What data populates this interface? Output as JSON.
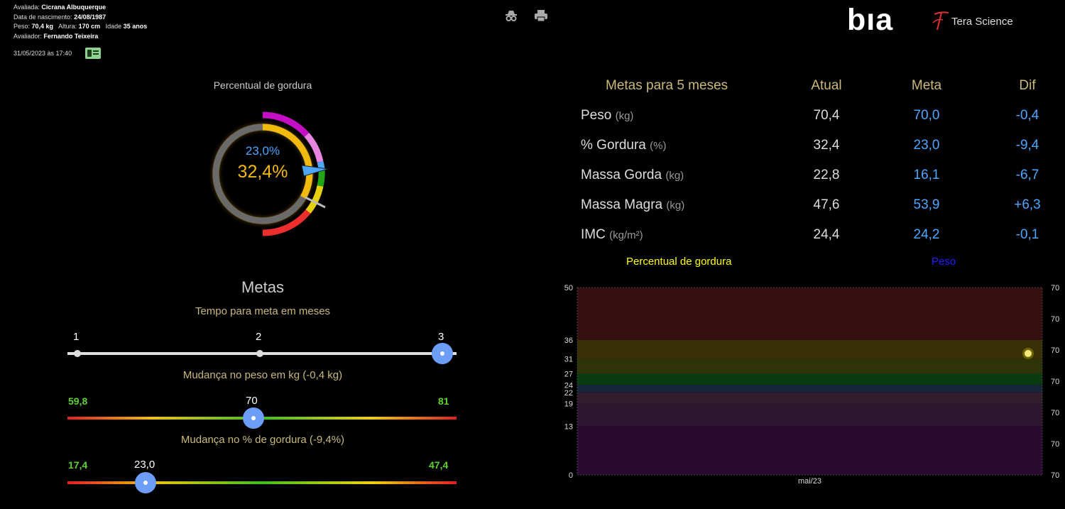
{
  "header": {
    "avaliada_label": "Avaliada:",
    "avaliada_value": "Cicrana Albuquerque",
    "nasc_label": "Data de nascimento:",
    "nasc_value": "24/08/1987",
    "peso_label": "Peso:",
    "peso_value": "70,4 kg",
    "altura_label": "Altura:",
    "altura_value": "170 cm",
    "idade_label": "Idade",
    "idade_value": "35 anos",
    "avaliador_label": "Avaliador:",
    "avaliador_value": "Fernando Teixeira",
    "datetime": "31/05/2023 às 17:40",
    "icons": [
      "id-card-icon",
      "incognito-icon",
      "printer-icon"
    ]
  },
  "logos": {
    "bia": "bıa",
    "tera": "Tera Science"
  },
  "gauge": {
    "title": "Percentual de gordura",
    "target": "23,0%",
    "current": "32,4%",
    "current_fraction": 0.324,
    "colors": {
      "current": "#f2b90f",
      "target": "#4da6ff",
      "track": "#6a6a6a"
    }
  },
  "metas": {
    "title": "Metas",
    "tempo": {
      "label": "Tempo para meta em meses",
      "ticks": [
        "1",
        "2",
        "3"
      ],
      "selected_index": 2
    },
    "peso": {
      "label": "Mudança no peso em kg (-0,4 kg)",
      "min": "59,8",
      "max": "81",
      "value": "70",
      "min_num": 59.8,
      "max_num": 81,
      "value_num": 70
    },
    "gordura": {
      "label": "Mudança no % de gordura (-9,4%)",
      "min": "17,4",
      "max": "47,4",
      "value": "23,0",
      "min_num": 17.4,
      "max_num": 47.4,
      "value_num": 23.0
    }
  },
  "goals_table": {
    "headers": [
      "Metas para 5 meses",
      "Atual",
      "Meta",
      "Dif"
    ],
    "rows": [
      {
        "label": "Peso",
        "unit": "(kg)",
        "atual": "70,4",
        "meta": "70,0",
        "dif": "-0,4"
      },
      {
        "label": "% Gordura",
        "unit": "(%)",
        "atual": "32,4",
        "meta": "23,0",
        "dif": "-9,4"
      },
      {
        "label": "Massa Gorda",
        "unit": "(kg)",
        "atual": "22,8",
        "meta": "16,1",
        "dif": "-6,7"
      },
      {
        "label": "Massa Magra",
        "unit": "(kg)",
        "atual": "47,6",
        "meta": "53,9",
        "dif": "+6,3"
      },
      {
        "label": "IMC",
        "unit": "(kg/m²)",
        "atual": "24,4",
        "meta": "24,2",
        "dif": "-0,1"
      }
    ]
  },
  "chart_data": {
    "type": "scatter",
    "series": [
      {
        "name": "Percentual de gordura",
        "color": "#ffff00",
        "x": [
          "mai/23"
        ],
        "y": [
          32.4
        ]
      },
      {
        "name": "Peso",
        "color": "#1f1fff",
        "x": [],
        "y": []
      }
    ],
    "x_ticks": [
      "mai/23"
    ],
    "y_left_ticks": [
      "0",
      "13",
      "19",
      "22",
      "24",
      "27",
      "31",
      "36",
      "50"
    ],
    "y_left_range": [
      0,
      50
    ],
    "y_right_ticks": [
      "70",
      "70",
      "70",
      "70",
      "70",
      "70",
      "70"
    ],
    "bands": [
      {
        "from": 0,
        "to": 13,
        "color": "#2a0a30"
      },
      {
        "from": 13,
        "to": 19,
        "color": "#2e1530"
      },
      {
        "from": 19,
        "to": 22,
        "color": "#321d2c"
      },
      {
        "from": 22,
        "to": 24,
        "color": "#15253a"
      },
      {
        "from": 24,
        "to": 27,
        "color": "#0a3a10"
      },
      {
        "from": 27,
        "to": 31,
        "color": "#2e3308"
      },
      {
        "from": 31,
        "to": 36,
        "color": "#3a3008"
      },
      {
        "from": 36,
        "to": 50,
        "color": "#351010"
      }
    ],
    "legend": "top"
  }
}
